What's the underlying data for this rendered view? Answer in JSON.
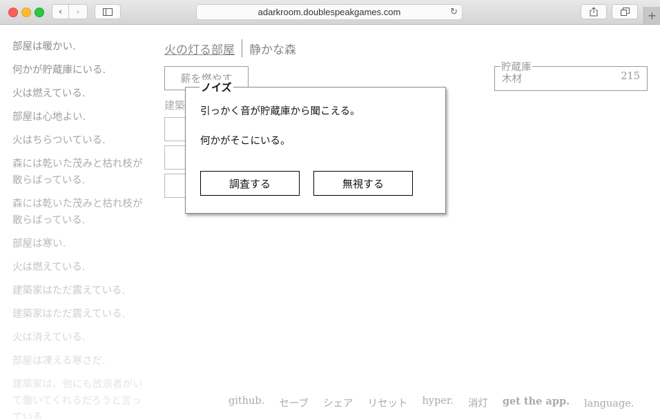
{
  "browser": {
    "url": "adarkroom.doublespeakgames.com"
  },
  "notifications": [
    {
      "text": "部屋は暖かい.",
      "color": "#8a8a8a"
    },
    {
      "text": "何かが貯蔵庫にいる.",
      "color": "#919191"
    },
    {
      "text": "火は燃えている.",
      "color": "#979797"
    },
    {
      "text": "部屋は心地よい.",
      "color": "#9d9d9d"
    },
    {
      "text": "火はちらついている.",
      "color": "#a4a4a4"
    },
    {
      "text": "森には乾いた茂みと枯れ枝が散らばっている.",
      "color": "#ababab"
    },
    {
      "text": "森には乾いた茂みと枯れ枝が散らばっている.",
      "color": "#b2b2b2"
    },
    {
      "text": "部屋は寒い.",
      "color": "#b9b9b9"
    },
    {
      "text": "火は燃えている.",
      "color": "#c1c1c1"
    },
    {
      "text": "建築家はただ震えている.",
      "color": "#c8c8c8"
    },
    {
      "text": "建築家はただ震えている.",
      "color": "#cfcfcf"
    },
    {
      "text": "火は消えている.",
      "color": "#d6d6d6"
    },
    {
      "text": "部屋は凍える寒さだ.",
      "color": "#dddddd"
    },
    {
      "text": "建築家は、他にも放浪者がいて働いてくれるだろうと言っている.",
      "color": "#e4e4e4"
    }
  ],
  "header": {
    "tab_room": "火の灯る部屋",
    "tab_forest": "静かな森"
  },
  "room": {
    "stoke_button": "薪を燃やす",
    "build_label": "建築"
  },
  "stores": {
    "legend": "貯蔵庫",
    "items": [
      {
        "name": "木材",
        "value": "215"
      }
    ]
  },
  "event": {
    "title": "ノイズ",
    "lines": [
      "引っかく音が貯蔵庫から聞こえる。",
      "何かがそこにいる。"
    ],
    "buttons": [
      "調査する",
      "無視する"
    ]
  },
  "footer": {
    "links": [
      "github.",
      "セーブ",
      "シェア",
      "リセット",
      "hyper.",
      "消灯",
      "get the app.",
      "language."
    ]
  }
}
